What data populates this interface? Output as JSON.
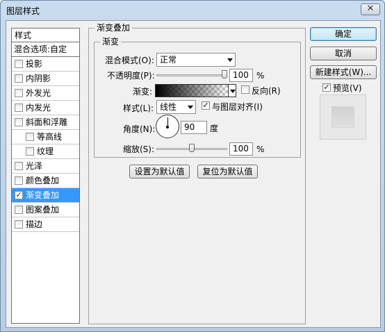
{
  "window": {
    "title": "图层样式",
    "close_glyph": "✕"
  },
  "styles": {
    "header": "样式",
    "blend_options": "混合选项:自定",
    "items": [
      {
        "label": "投影",
        "checked": false
      },
      {
        "label": "内阴影",
        "checked": false
      },
      {
        "label": "外发光",
        "checked": false
      },
      {
        "label": "内发光",
        "checked": false
      },
      {
        "label": "斜面和浮雕",
        "checked": false
      },
      {
        "label": "等高线",
        "checked": false,
        "sub": true
      },
      {
        "label": "纹理",
        "checked": false,
        "sub": true
      },
      {
        "label": "光泽",
        "checked": false
      },
      {
        "label": "颜色叠加",
        "checked": false
      },
      {
        "label": "渐变叠加",
        "checked": true,
        "selected": true
      },
      {
        "label": "图案叠加",
        "checked": false
      },
      {
        "label": "描边",
        "checked": false
      }
    ]
  },
  "gradient_overlay": {
    "group_title": "渐变叠加",
    "sub_title": "渐变",
    "blend_mode_label": "混合模式(O):",
    "blend_mode_value": "正常",
    "opacity_label": "不透明度(P):",
    "opacity_value": "100",
    "opacity_fraction": 1.0,
    "percent": "%",
    "gradient_label": "渐变:",
    "reverse_label": "反向(R)",
    "reverse_checked": false,
    "style_label": "样式(L):",
    "style_value": "线性",
    "align_label": "与图层对齐(I)",
    "align_checked": true,
    "angle_label": "角度(N):",
    "angle_value": "90",
    "angle_unit": "度",
    "scale_label": "缩放(S):",
    "scale_value": "100",
    "scale_fraction": 0.5,
    "set_default": "设置为默认值",
    "reset_default": "复位为默认值"
  },
  "actions": {
    "ok": "确定",
    "cancel": "取消",
    "new_style": "新建样式(W)...",
    "preview_label": "预览(V)",
    "preview_checked": true
  }
}
